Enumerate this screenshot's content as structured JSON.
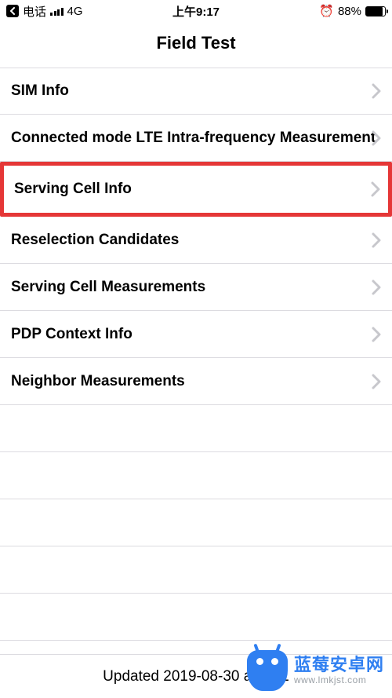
{
  "status": {
    "back_app": "电话",
    "network": "4G",
    "time": "上午9:17",
    "battery_pct": "88%"
  },
  "nav": {
    "title": "Field Test"
  },
  "rows": [
    {
      "label": "SIM Info"
    },
    {
      "label": "Connected mode LTE Intra-frequency Measurement"
    },
    {
      "label": "Serving Cell Info",
      "highlighted": true
    },
    {
      "label": "Reselection Candidates"
    },
    {
      "label": "Serving Cell Measurements"
    },
    {
      "label": "PDP Context Info"
    },
    {
      "label": "Neighbor Measurements"
    }
  ],
  "footer": {
    "updated": "Updated 2019-08-30 at 09:1"
  },
  "watermark": {
    "title": "蓝莓安卓网",
    "url": "www.lmkjst.com"
  }
}
